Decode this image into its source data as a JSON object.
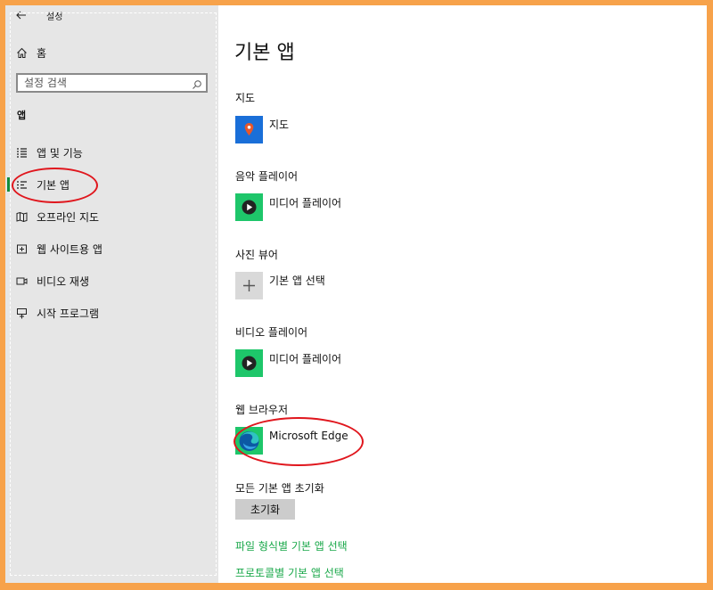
{
  "window": {
    "title": "설정"
  },
  "sidebar": {
    "home_label": "홈",
    "search_placeholder": "설정 검색",
    "section_label": "앱",
    "items": [
      {
        "label": "앱 및 기능",
        "icon": "apps-features-icon"
      },
      {
        "label": "기본 앱",
        "icon": "default-apps-icon",
        "active": true
      },
      {
        "label": "오프라인 지도",
        "icon": "offline-maps-icon"
      },
      {
        "label": "웹 사이트용 앱",
        "icon": "apps-for-websites-icon"
      },
      {
        "label": "비디오 재생",
        "icon": "video-playback-icon"
      },
      {
        "label": "시작 프로그램",
        "icon": "startup-icon"
      }
    ]
  },
  "main": {
    "title": "기본 앱",
    "groups": [
      {
        "label": "지도",
        "app": "지도",
        "icon": "maps-app-icon",
        "tile_color": "#1a6fd8"
      },
      {
        "label": "음악 플레이어",
        "app": "미디어 플레이어",
        "icon": "media-player-icon",
        "tile_color": "#1ec66a"
      },
      {
        "label": "사진 뷰어",
        "app": "기본 앱 선택",
        "icon": "plus-icon",
        "tile_color": "#d9d9d9"
      },
      {
        "label": "비디오 플레이어",
        "app": "미디어 플레이어",
        "icon": "media-player-icon",
        "tile_color": "#1ec66a"
      },
      {
        "label": "웹 브라우저",
        "app": "Microsoft Edge",
        "icon": "edge-browser-icon",
        "tile_color": "#1ec66a"
      }
    ],
    "reset_label": "모든 기본 앱 초기화",
    "reset_button": "초기화",
    "links": [
      "파일 형식별 기본 앱 선택",
      "프로토콜별 기본 앱 선택"
    ]
  },
  "colors": {
    "accent": "#0f8c3c",
    "link": "#1aa84a",
    "annotation": "#e0161d",
    "frame": "#f7a24a"
  }
}
